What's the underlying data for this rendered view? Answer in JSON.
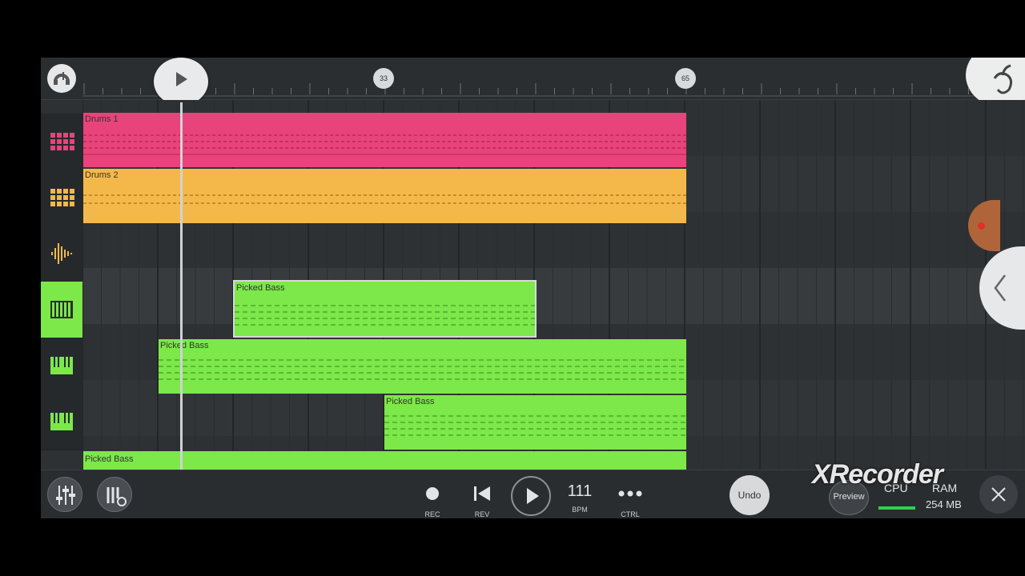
{
  "ruler": {
    "markers": [
      "33",
      "65"
    ]
  },
  "tracks": [
    {
      "icon": "drum-pattern-icon",
      "color": "#e8437a",
      "clips": [
        {
          "name": "Drums 1"
        }
      ]
    },
    {
      "icon": "drum-pattern-icon",
      "color": "#f4b84a",
      "clips": [
        {
          "name": "Drums 2"
        }
      ]
    },
    {
      "icon": "audio-waveform-icon",
      "color": "#f4b84a",
      "clips": []
    },
    {
      "icon": "piano-keys-icon",
      "color": "#7ce84a",
      "selected": true,
      "clips": [
        {
          "name": "Picked Bass"
        }
      ]
    },
    {
      "icon": "piano-keys-icon",
      "color": "#7ce84a",
      "clips": [
        {
          "name": "Picked Bass"
        }
      ]
    },
    {
      "icon": "piano-keys-icon",
      "color": "#7ce84a",
      "clips": [
        {
          "name": "Picked Bass"
        }
      ]
    },
    {
      "icon": "piano-keys-icon",
      "color": "#7ce84a",
      "clips": [
        {
          "name": "Picked Bass"
        }
      ]
    }
  ],
  "transport": {
    "rec_label": "REC",
    "rev_label": "REV",
    "bpm_value": "111",
    "bpm_label": "BPM",
    "ctrl_label": "CTRL",
    "undo_label": "Undo",
    "preview_label": "Preview",
    "cpu_label": "CPU",
    "ram_label": "RAM",
    "ram_value": "254 MB"
  },
  "watermark": "XRecorder",
  "colors": {
    "drums1": "#e8437a",
    "drums2": "#f4b84a",
    "bass": "#7ce84a",
    "background": "#2d3033"
  }
}
